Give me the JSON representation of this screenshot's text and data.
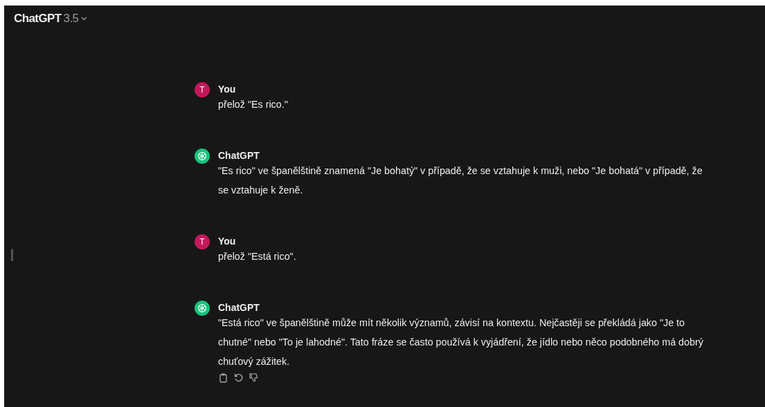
{
  "header": {
    "model_name": "ChatGPT",
    "model_version": "3.5"
  },
  "messages": [
    {
      "kind": "user",
      "avatar_letter": "T",
      "author": "You",
      "text": "přelož \"Es rico.\""
    },
    {
      "kind": "assistant",
      "author": "ChatGPT",
      "text": "\"Es rico\" ve španělštině znamená \"Je bohatý\" v případě, že se vztahuje k muži, nebo \"Je bohatá\" v případě, že se vztahuje k ženě."
    },
    {
      "kind": "user",
      "avatar_letter": "T",
      "author": "You",
      "text": "přelož \"Está rico\"."
    },
    {
      "kind": "assistant",
      "author": "ChatGPT",
      "text": "\"Está rico\" ve španělštině může mít několik významů, závisí na kontextu. Nejčastěji se překládá jako \"Je to chutné\" nebo \"To je lahodné\". Tato fráze se často používá k vyjádření, že jídlo nebo něco podobného má dobrý chuťový zážitek.",
      "actions": [
        {
          "kind": "copy"
        },
        {
          "kind": "regenerate"
        },
        {
          "kind": "thumbs_down"
        }
      ]
    }
  ]
}
